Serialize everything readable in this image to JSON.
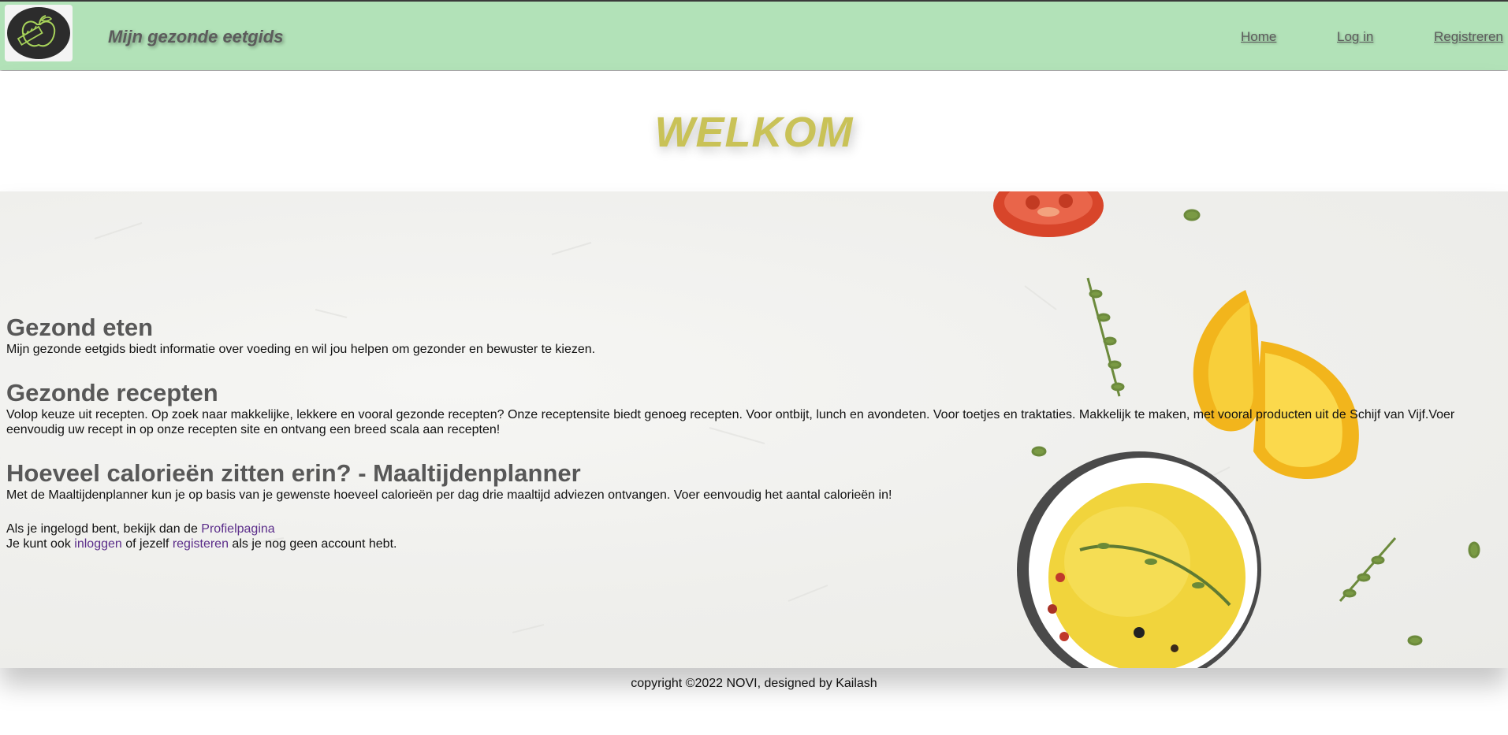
{
  "header": {
    "site_title": "Mijn gezonde eetgids",
    "logo_icon": "apple-measuring-tape-logo-icon",
    "nav": {
      "home": "Home",
      "login": "Log in",
      "register": "Registreren"
    },
    "background_color": "#b2e2b8"
  },
  "welcome": {
    "title": "WELKOM",
    "color": "#c9c257"
  },
  "sections": {
    "healthy_eating": {
      "heading": "Gezond eten",
      "text": "Mijn gezonde eetgids biedt informatie over voeding en wil jou helpen om gezonder en bewuster te kiezen."
    },
    "healthy_recipes": {
      "heading": "Gezonde recepten",
      "text": "Volop keuze uit recepten. Op zoek naar makkelijke, lekkere en vooral gezonde recepten? Onze receptensite biedt genoeg recepten. Voor ontbijt, lunch en avondeten. Voor toetjes en traktaties. Makkelijk te maken, met vooral producten uit de Schijf van Vijf.Voer eenvoudig uw recept in op onze recepten site en ontvang een breed scala aan recepten!"
    },
    "calories": {
      "heading": "Hoeveel calorieën zitten erin? - Maaltijdenplanner",
      "text": "Met de Maaltijdenplanner kun je op basis van je gewenste hoeveel calorieën per dag drie maaltijd adviezen ontvangen. Voer eenvoudig het aantal calorieën in!"
    }
  },
  "account_info": {
    "line1_prefix": "Als je ingelogd bent, bekijk dan de ",
    "profile_link": "Profielpagina",
    "line2_prefix": "Je kunt ook ",
    "login_link": "inloggen",
    "line2_middle": " of jezelf ",
    "register_link": "registeren",
    "line2_suffix": " als je nog geen account hebt."
  },
  "footer": {
    "text": "copyright ©2022 NOVI, designed by Kailash"
  }
}
